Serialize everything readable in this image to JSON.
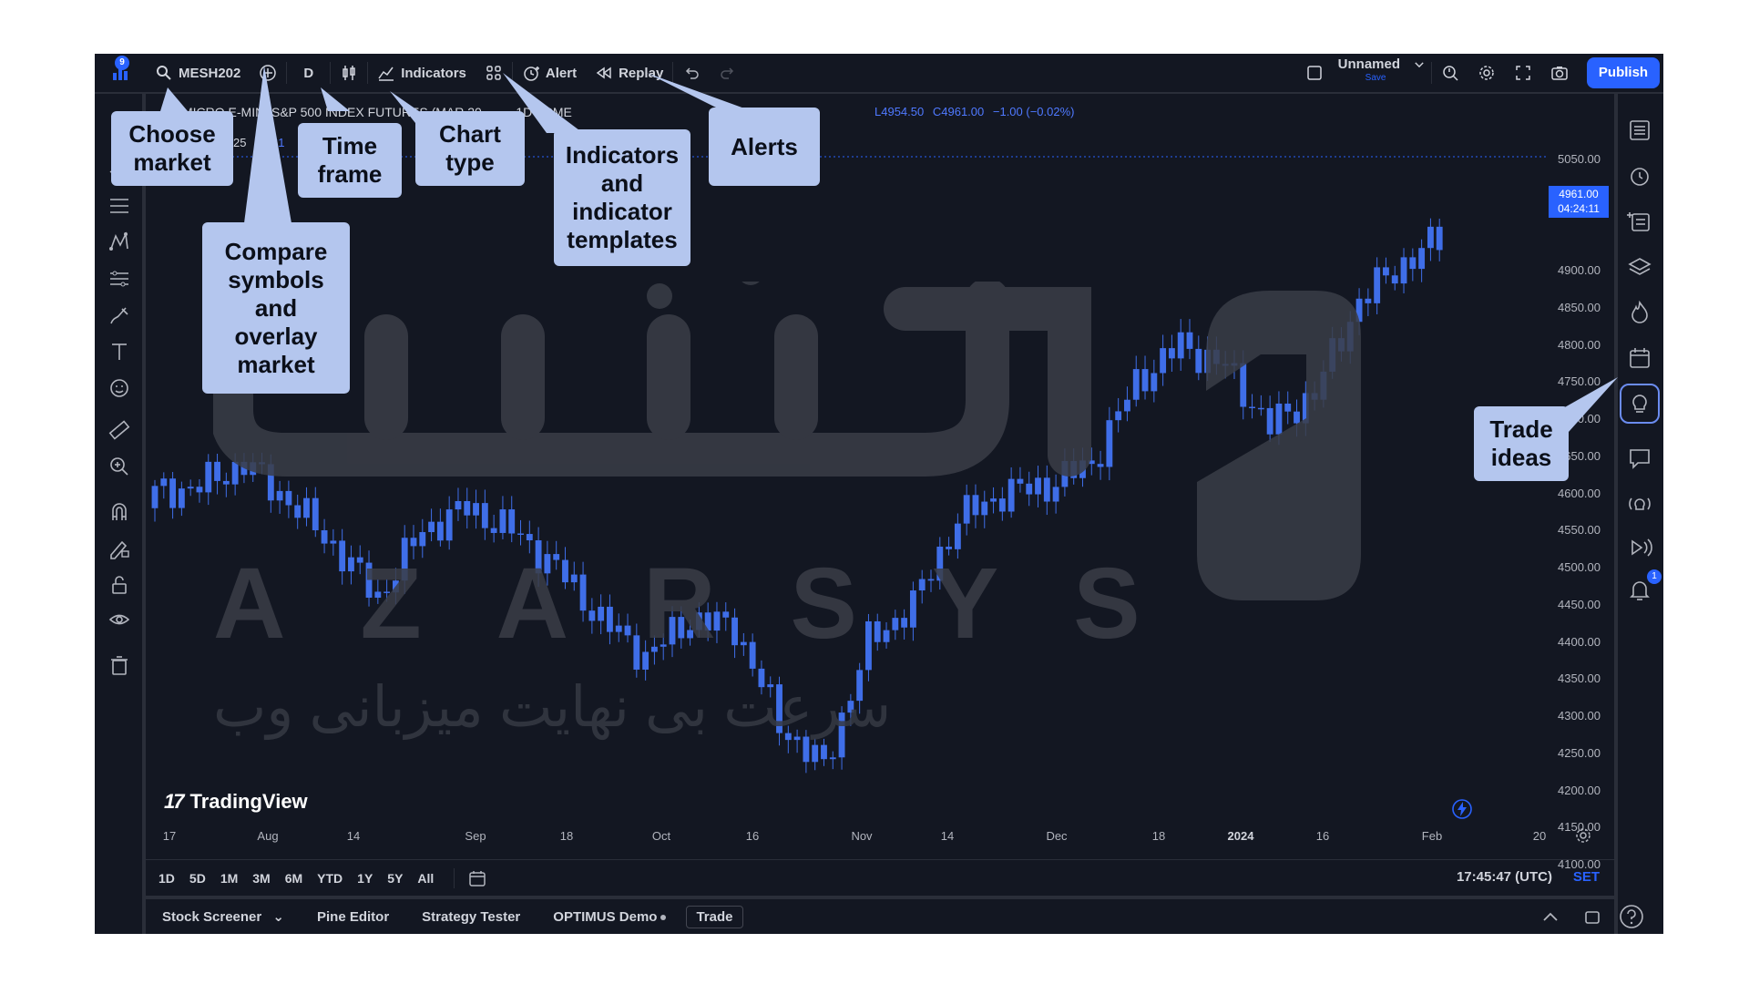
{
  "topbar": {
    "alerts_badge": "9",
    "symbol": "MESH202",
    "interval": "D",
    "indicators_label": "Indicators",
    "alert_label": "Alert",
    "replay_label": "Replay",
    "layout_name": "Unnamed",
    "layout_sub": "Save",
    "publish_label": "Publish"
  },
  "legend": {
    "symbol_title": "MICRO E-MINI S&P 500 INDEX FUTURES (MAR 20...",
    "interval_exchange": "1D · CME",
    "ohlc_low": "L4954.50",
    "ohlc_close": "C4961.00",
    "ohlc_change": "−1.00 (−0.02%)",
    "partial_a": "25",
    "partial_b": "61"
  },
  "price_axis": {
    "ticks": [
      "5050.00",
      "5000.00",
      "4900.00",
      "4850.00",
      "4800.00",
      "4750.00",
      "4700.00",
      "4650.00",
      "4600.00",
      "4550.00",
      "4500.00",
      "4450.00",
      "4400.00",
      "4350.00",
      "4300.00",
      "4250.00",
      "4200.00",
      "4150.00",
      "4100.00"
    ],
    "current_price": "4961.00",
    "countdown": "04:24:11"
  },
  "time_axis": {
    "ticks": [
      {
        "label": "17",
        "bold": false
      },
      {
        "label": "Aug",
        "bold": false
      },
      {
        "label": "14",
        "bold": false
      },
      {
        "label": "Sep",
        "bold": false
      },
      {
        "label": "18",
        "bold": false
      },
      {
        "label": "Oct",
        "bold": false
      },
      {
        "label": "16",
        "bold": false
      },
      {
        "label": "Nov",
        "bold": false
      },
      {
        "label": "14",
        "bold": false
      },
      {
        "label": "Dec",
        "bold": false
      },
      {
        "label": "18",
        "bold": false
      },
      {
        "label": "2024",
        "bold": true
      },
      {
        "label": "16",
        "bold": false
      },
      {
        "label": "Feb",
        "bold": false
      },
      {
        "label": "20",
        "bold": false
      }
    ]
  },
  "brand": {
    "tradingview": "TradingView"
  },
  "ranges": {
    "items": [
      "1D",
      "5D",
      "1M",
      "3M",
      "6M",
      "YTD",
      "1Y",
      "5Y",
      "All"
    ],
    "clock": "17:45:47 (UTC)",
    "session": "SET"
  },
  "bottombar": {
    "stock_screener": "Stock Screener",
    "pine_editor": "Pine Editor",
    "strategy_tester": "Strategy Tester",
    "optimus_demo": "OPTIMUS Demo",
    "trade": "Trade"
  },
  "watermark": {
    "latin": "AZARSYS",
    "persian": "سرعت بی نهایت میزبانی وب"
  },
  "callouts": {
    "choose_market": [
      "Choose",
      "market"
    ],
    "compare_symbols": [
      "Compare",
      "symbols",
      "and",
      "overlay",
      "market"
    ],
    "time_frame": [
      "Time",
      "frame"
    ],
    "chart_type": [
      "Chart",
      "type"
    ],
    "indicators_templates": [
      "Indicators",
      "and",
      "indicator",
      "templates"
    ],
    "alerts": [
      "Alerts"
    ],
    "trade_ideas": [
      "Trade",
      "ideas"
    ]
  },
  "colors": {
    "background": "#131722",
    "accent": "#2962ff",
    "candle": "#3f6ee8",
    "callout": "#b4c6ee"
  },
  "chart_data": {
    "type": "candlestick",
    "ylim": [
      4100,
      5050
    ],
    "x": [
      "Jul 17",
      "Jul 24",
      "Jul 31",
      "Aug 7",
      "Aug 14",
      "Aug 21",
      "Aug 28",
      "Sep 4",
      "Sep 11",
      "Sep 18",
      "Sep 25",
      "Oct 2",
      "Oct 9",
      "Oct 16",
      "Oct 23",
      "Oct 30",
      "Nov 6",
      "Nov 13",
      "Nov 20",
      "Nov 27",
      "Dec 4",
      "Dec 11",
      "Dec 18",
      "Dec 26",
      "Jan 2",
      "Jan 8",
      "Jan 16",
      "Jan 22",
      "Jan 29",
      "Feb 5"
    ],
    "close": [
      4610,
      4620,
      4650,
      4600,
      4540,
      4470,
      4560,
      4590,
      4560,
      4510,
      4440,
      4390,
      4440,
      4430,
      4300,
      4240,
      4410,
      4460,
      4575,
      4610,
      4620,
      4650,
      4760,
      4810,
      4780,
      4700,
      4745,
      4870,
      4920,
      4961
    ]
  }
}
